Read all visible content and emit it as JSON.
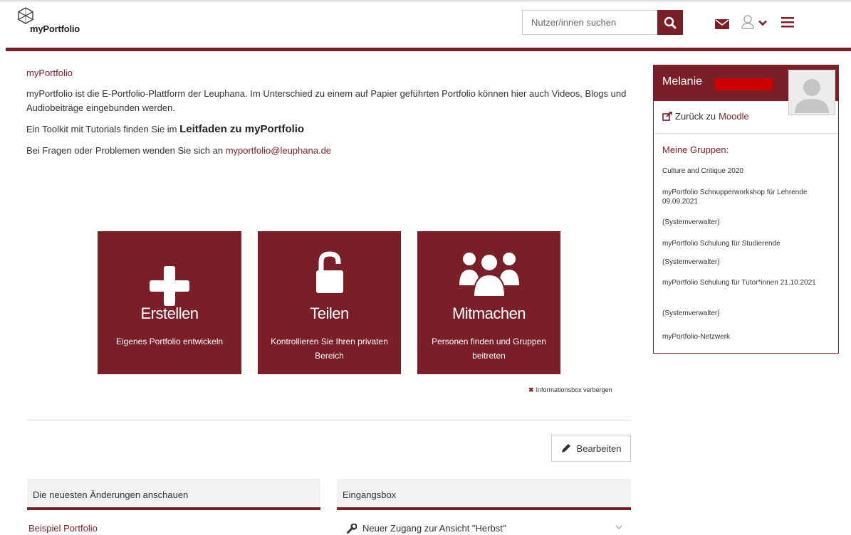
{
  "app": {
    "logo_text": "myPortfolio"
  },
  "header": {
    "search_placeholder": "Nutzer/innen suchen",
    "accent": "#7a1e28"
  },
  "intro": {
    "title": "myPortfolio",
    "description": "myPortfolio ist die E-Portfolio-Plattform der Leuphana. Im Unterschied zu einem auf Papier geführten Portfolio können hier auch Videos, Blogs und Audiobeiträge eingebunden werden.",
    "toolkit_prefix": "Ein Toolkit mit Tutorials finden Sie im",
    "toolkit_link": "Leitfaden zu myPortfolio",
    "contact_prefix": "Bei Fragen oder Problemen wenden Sie sich an",
    "contact_email": "myportfolio@leuphana.de"
  },
  "tiles": [
    {
      "title": "Erstellen",
      "subtitle": "Eigenes Portfolio entwickeln",
      "icon": "plus-icon"
    },
    {
      "title": "Teilen",
      "subtitle": "Kontrollieren Sie Ihren privaten Bereich",
      "icon": "unlock-icon"
    },
    {
      "title": "Mitmachen",
      "subtitle": "Personen finden und Gruppen beitreten",
      "icon": "users-icon"
    }
  ],
  "hide_infobox": "Informationsbox verbergen",
  "edit_button": "Bearbeiten",
  "panels": {
    "recent": {
      "title": "Die neuesten Änderungen anschauen",
      "item": "Beispiel Portfolio"
    },
    "inbox": {
      "title": "Eingangsbox",
      "item": "Neuer Zugang zur Ansicht \"Herbst\""
    }
  },
  "sidebar": {
    "user_name": "Melanie",
    "back_prefix": "Zurück zu",
    "back_link": "Moodle",
    "groups_title": "Meine Gruppen:",
    "groups": [
      "Culture and Critique 2020",
      "myPortfolio Schnupperworkshop für Lehrende 09.09.2021",
      "(Systemverwalter)",
      "myPortfolio Schulung für Studierende",
      "(Systemverwalter)",
      "myPortfolio Schulung für Tutor*innen 21.10.2021",
      "(Systemverwalter)",
      "myPortfolio-Netzwerk"
    ]
  }
}
